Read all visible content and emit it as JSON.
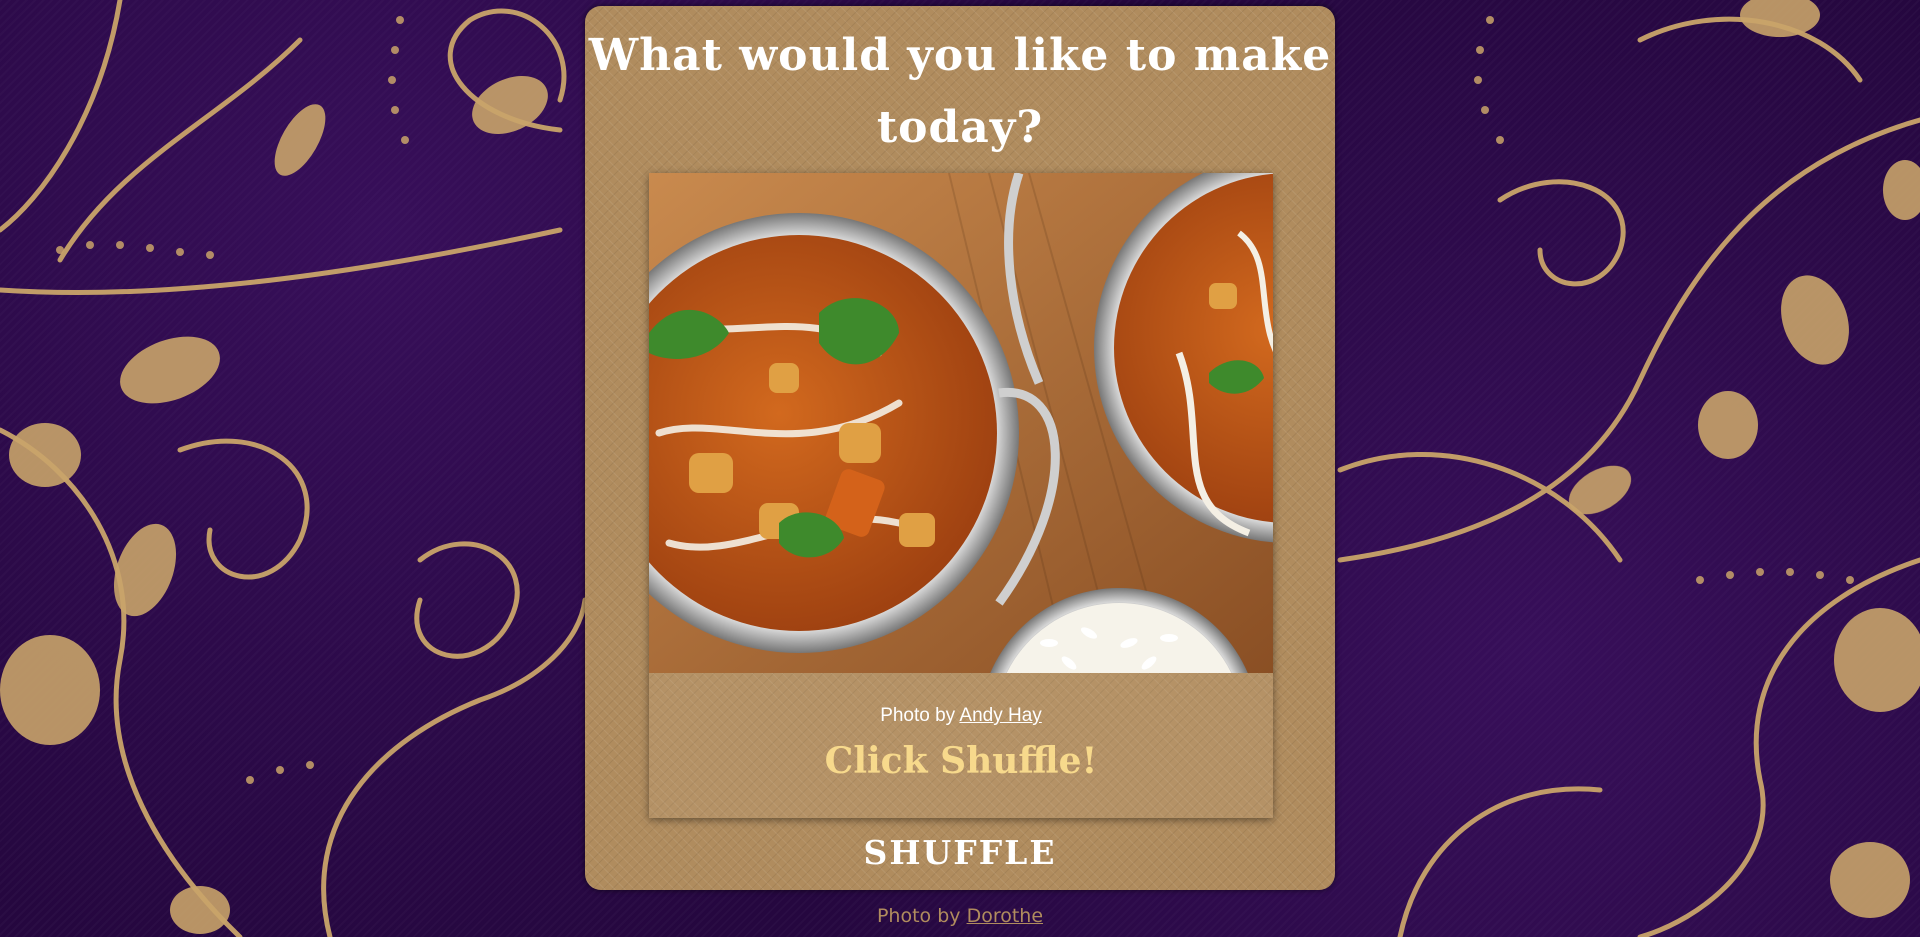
{
  "heading": "What would you like to make today?",
  "recipe_card": {
    "photo_alt": "Curry in metal bowls with rice",
    "credit_prefix": "Photo by",
    "credit_author": "Andy Hay",
    "prompt": "Click Shuffle!"
  },
  "shuffle_button": {
    "label": "SHUFFLE"
  },
  "background_credit": {
    "prefix": "Photo by",
    "author": "Dorothe"
  },
  "colors": {
    "background": "#25073f",
    "ornament_gold": "#c9a46a",
    "card": "#b08c5e",
    "prompt_text": "#f7d98c",
    "heading_text": "#ffffff"
  },
  "icons": {
    "background": "floral-ornament-pattern"
  }
}
